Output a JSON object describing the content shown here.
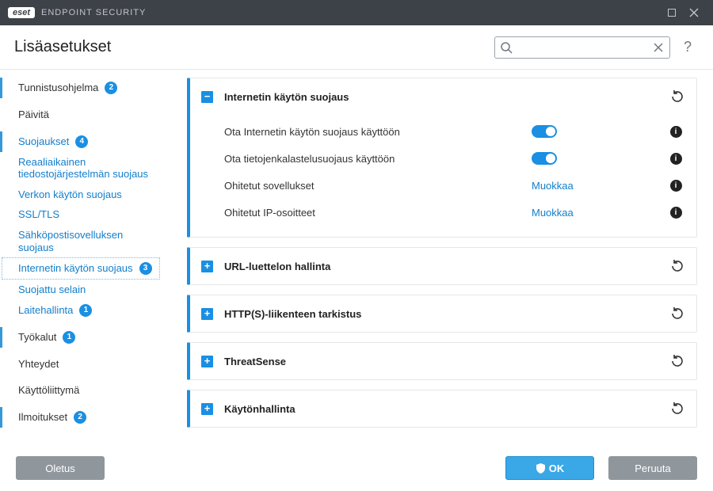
{
  "window": {
    "app_brand": "eset",
    "app_name": "ENDPOINT SECURITY"
  },
  "header": {
    "title": "Lisäasetukset",
    "search_placeholder": ""
  },
  "sidebar": {
    "tunnistus": {
      "label": "Tunnistusohjelma",
      "badge": "2"
    },
    "paivita": {
      "label": "Päivitä"
    },
    "suojaukset": {
      "label": "Suojaukset",
      "badge": "4"
    },
    "sub_realtime": {
      "label": "Reaaliaikainen tiedostojärjestelmän suojaus"
    },
    "sub_network": {
      "label": "Verkon käytön suojaus"
    },
    "sub_ssl": {
      "label": "SSL/TLS"
    },
    "sub_mail": {
      "label": "Sähköpostisovelluksen suojaus"
    },
    "sub_web": {
      "label": "Internetin käytön suojaus",
      "badge": "3"
    },
    "sub_browser": {
      "label": "Suojattu selain"
    },
    "sub_device": {
      "label": "Laitehallinta",
      "badge": "1"
    },
    "tyokalut": {
      "label": "Työkalut",
      "badge": "1"
    },
    "yhteydet": {
      "label": "Yhteydet"
    },
    "kayttoliittyma": {
      "label": "Käyttöliittymä"
    },
    "ilmoitukset": {
      "label": "Ilmoitukset",
      "badge": "2"
    }
  },
  "cards": {
    "web": {
      "title": "Internetin käytön suojaus",
      "rows": {
        "enable_web": {
          "label": "Ota Internetin käytön suojaus käyttöön"
        },
        "enable_phish": {
          "label": "Ota tietojenkalastelusuojaus käyttöön"
        },
        "excluded_apps": {
          "label": "Ohitetut sovellukset",
          "action": "Muokkaa"
        },
        "excluded_ips": {
          "label": "Ohitetut IP-osoitteet",
          "action": "Muokkaa"
        }
      }
    },
    "url": {
      "title": "URL-luettelon hallinta"
    },
    "https": {
      "title": "HTTP(S)-liikenteen tarkistus"
    },
    "threat": {
      "title": "ThreatSense"
    },
    "scan": {
      "title": "Käytönhallinta"
    }
  },
  "footer": {
    "default": "Oletus",
    "ok": "OK",
    "cancel": "Peruuta"
  }
}
